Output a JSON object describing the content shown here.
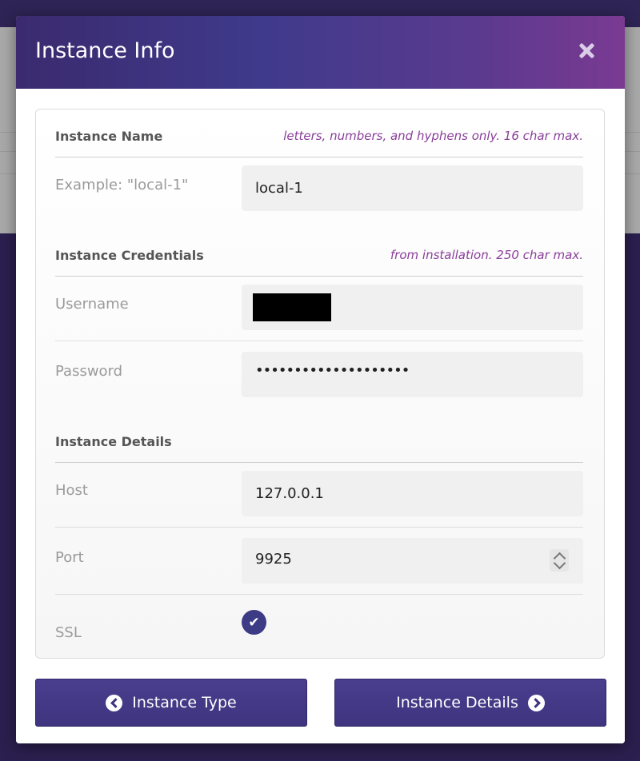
{
  "modal": {
    "title": "Instance Info"
  },
  "sections": {
    "name": {
      "label": "Instance Name",
      "hint": "letters, numbers, and hyphens only. 16 char max.",
      "example_label": "Example: \"local-1\"",
      "value": "local-1"
    },
    "credentials": {
      "label": "Instance Credentials",
      "hint": "from installation. 250 char max.",
      "username_label": "Username",
      "password_label": "Password",
      "password_masked": "••••••••••••••••••••"
    },
    "details": {
      "label": "Instance Details",
      "host_label": "Host",
      "host_value": "127.0.0.1",
      "port_label": "Port",
      "port_value": "9925",
      "ssl_label": "SSL",
      "ssl_checked": true
    }
  },
  "buttons": {
    "back_label": "Instance Type",
    "next_label": "Instance Details"
  },
  "colors": {
    "header_start": "#3b2a6e",
    "header_end": "#7a3a92",
    "accent": "#3e347f",
    "hint": "#8a3e9a"
  }
}
